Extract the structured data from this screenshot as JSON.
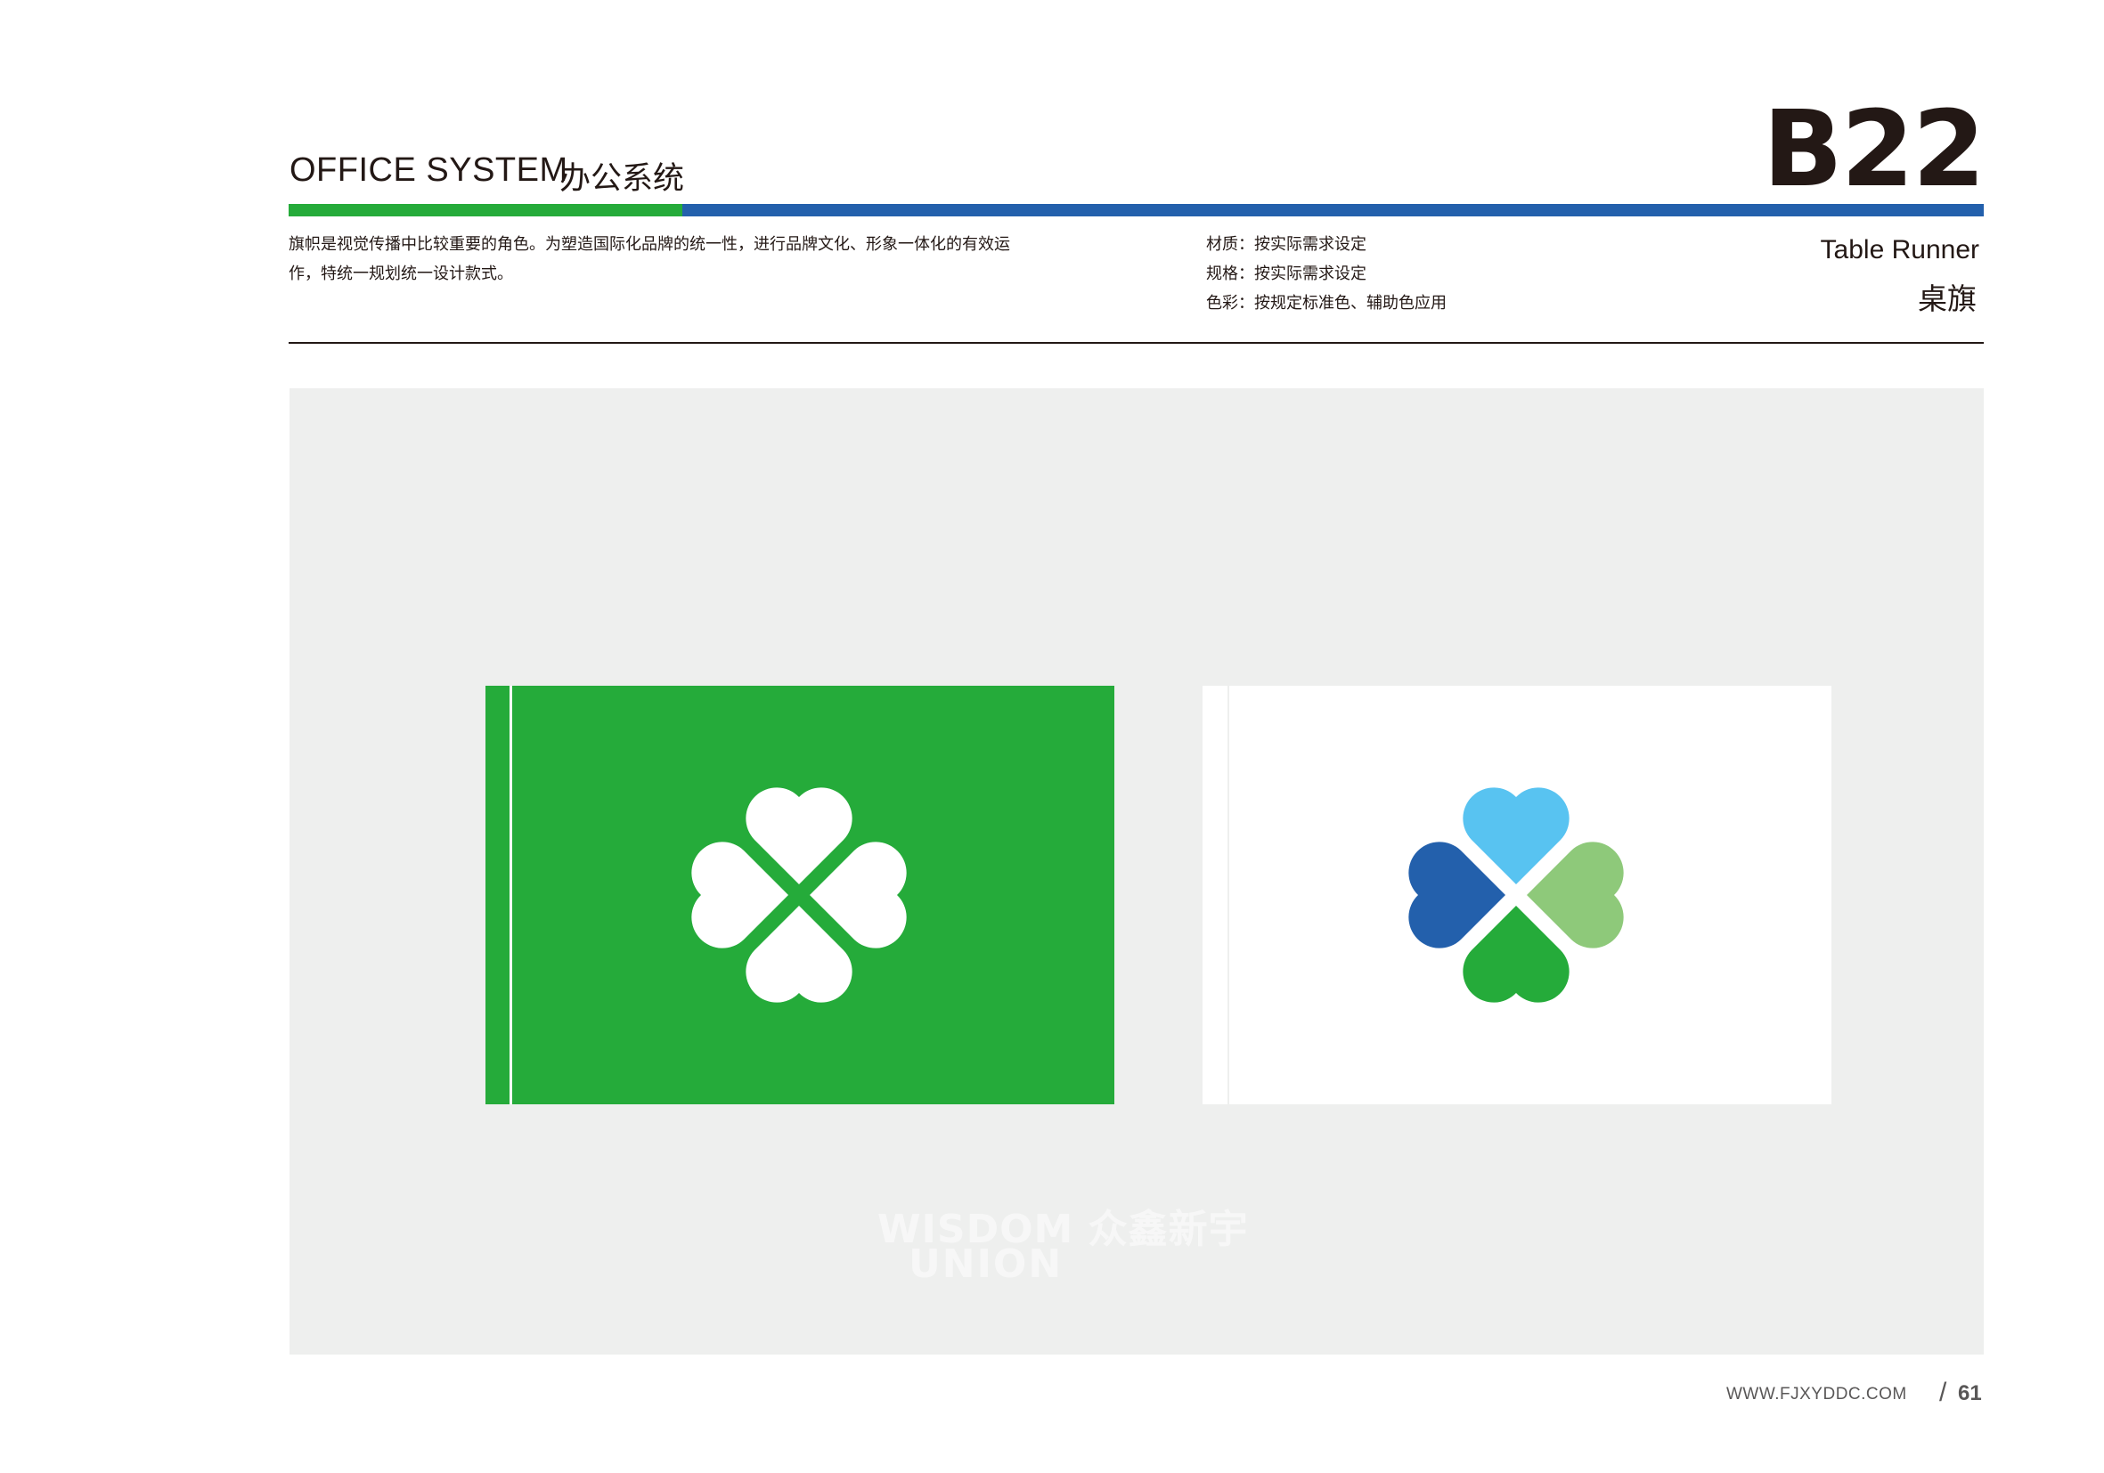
{
  "header": {
    "title_en": "OFFICE SYSTEM",
    "title_cn": "办公系统",
    "code": "B22",
    "subtitle_en": "Table Runner",
    "subtitle_cn": "桌旗"
  },
  "description": [
    "旗帜是视觉传播中比较重要的角色。为塑造国际化品牌的统一性，进行品牌文化、形象一体化的有效运",
    "作，特统一规划统一设计款式。"
  ],
  "specs": [
    "材质：按实际需求设定",
    "规格：按实际需求设定",
    "色彩：按规定标准色、辅助色应用"
  ],
  "watermark": {
    "line1": "WISDOM 众鑫新宇",
    "line2": "UNION"
  },
  "footer": {
    "url": "WWW.FJXYDDC.COM",
    "slash": "/",
    "page": "61"
  },
  "colors": {
    "brand_green": "#25AB3A",
    "brand_blue": "#2360AC",
    "light_blue": "#58C3F1",
    "light_green": "#8EC97A",
    "panel_bg": "#EEEFEE",
    "text_dark": "#231815"
  },
  "icons": {
    "logo": "four-heart-clover-logo"
  }
}
